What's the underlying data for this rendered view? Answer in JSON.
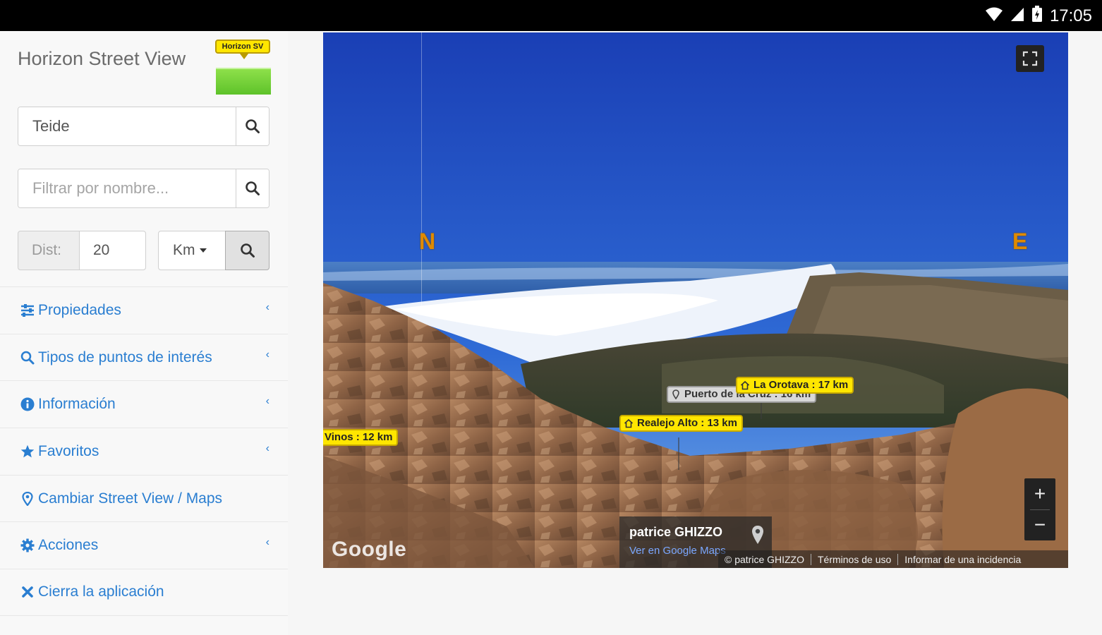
{
  "status_bar": {
    "time": "17:05"
  },
  "sidebar": {
    "app_title": "Horizon Street View",
    "logo_label": "Horizon SV",
    "search": {
      "value": "Teide"
    },
    "filter": {
      "placeholder": "Filtrar por nombre..."
    },
    "distance": {
      "label": "Dist:",
      "value": "20",
      "unit": "Km"
    },
    "menu": [
      {
        "label": "Propiedades",
        "icon": "sliders-icon",
        "has_chevron": true
      },
      {
        "label": "Tipos de puntos de interés",
        "icon": "search-icon",
        "has_chevron": true
      },
      {
        "label": "Información",
        "icon": "info-icon",
        "has_chevron": true
      },
      {
        "label": "Favoritos",
        "icon": "star-icon",
        "has_chevron": true
      },
      {
        "label": "Cambiar Street View / Maps",
        "icon": "map-marker-icon",
        "has_chevron": false
      },
      {
        "label": "Acciones",
        "icon": "gear-icon",
        "has_chevron": true
      },
      {
        "label": "Cierra la aplicación",
        "icon": "close-icon",
        "has_chevron": false
      }
    ]
  },
  "panorama": {
    "compass": {
      "north": "N",
      "east": "E"
    },
    "pois": [
      {
        "label": "Vinos : 12 km",
        "style": "yellow"
      },
      {
        "label": "Realejo Alto : 13 km",
        "style": "yellow"
      },
      {
        "label": "Puerto de la Cruz : 16 km",
        "style": "gray"
      },
      {
        "label": "La Orotava : 17 km",
        "style": "yellow"
      }
    ],
    "google_logo": "Google",
    "author": {
      "name": "patrice GHIZZO",
      "link": "Ver en Google Maps"
    },
    "footer": {
      "copyright": "© patrice GHIZZO",
      "terms": "Términos de uso",
      "report": "Informar de una incidencia"
    },
    "zoom": {
      "in": "+",
      "out": "−"
    }
  },
  "colors": {
    "accent": "#2a7ed1",
    "poi_yellow": "#ffe600",
    "compass": "#e08a00",
    "sky_top": "#1d43b8",
    "sky_horizon": "#6aa0e6"
  }
}
